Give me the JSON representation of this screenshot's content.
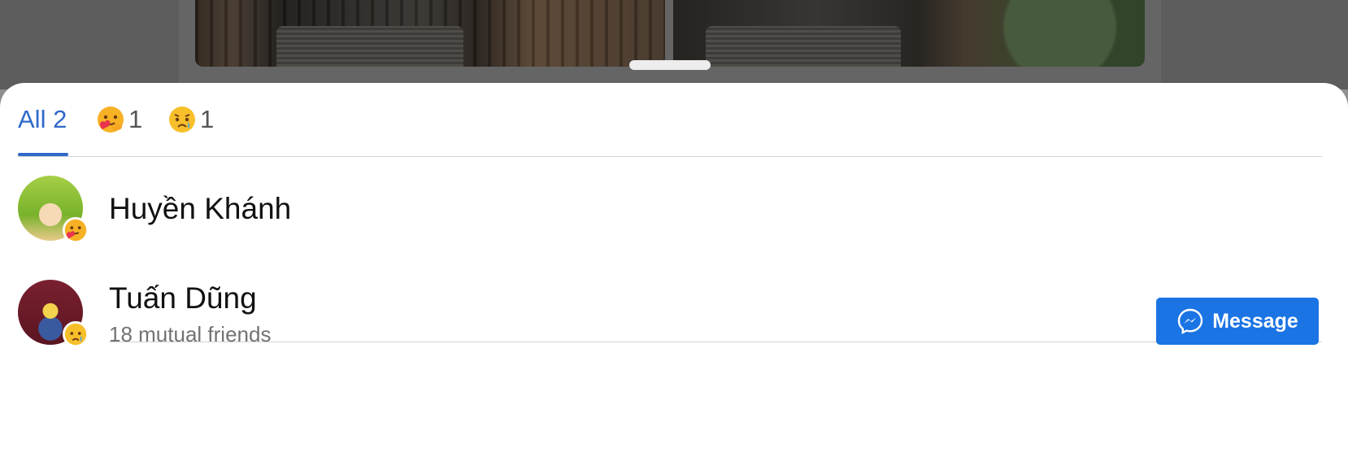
{
  "background": {
    "dim_color": "#000000"
  },
  "tabs": [
    {
      "label": "All 2",
      "active": true,
      "accent": "#2f69c9"
    },
    {
      "label": "1",
      "icon": "care-reaction-icon"
    },
    {
      "label": "1",
      "icon": "sad-reaction-icon"
    }
  ],
  "people": [
    {
      "name": "Huyền Khánh",
      "reaction": "care-reaction-icon"
    },
    {
      "name": "Tuấn Dũng",
      "subtitle": "18 mutual friends",
      "reaction": "sad-reaction-icon",
      "action_label": "Message",
      "action_icon": "messenger-icon"
    }
  ],
  "colors": {
    "button": "#1b74e4"
  }
}
